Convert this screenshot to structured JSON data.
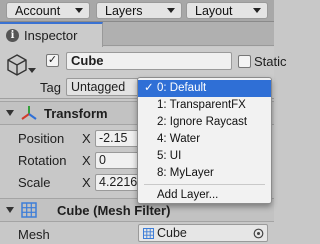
{
  "toolbar": {
    "account": "Account",
    "layers": "Layers",
    "layout": "Layout"
  },
  "tab": {
    "label": "Inspector"
  },
  "object": {
    "name": "Cube",
    "static_label": "Static",
    "tag_label": "Tag",
    "tag_value": "Untagged"
  },
  "transform": {
    "title": "Transform",
    "rows": [
      {
        "label": "Position",
        "x": "-2.15"
      },
      {
        "label": "Rotation",
        "x": "0"
      },
      {
        "label": "Scale",
        "x": "4.2216"
      }
    ],
    "axis_x": "X"
  },
  "mesh_filter": {
    "title": "Cube (Mesh Filter)",
    "mesh_label": "Mesh",
    "mesh_value": "Cube"
  },
  "layer_menu": {
    "check": "✓",
    "items": [
      "0: Default",
      "1: TransparentFX",
      "2: Ignore Raycast",
      "4: Water",
      "5: UI",
      "8: MyLayer"
    ],
    "add_layer": "Add Layer..."
  },
  "colors": {
    "selection": "#2f6fd6",
    "tab_accent": "#3a72d2",
    "transform_red": "#d23b2b",
    "transform_green": "#34a03b",
    "transform_blue": "#2f6fd6",
    "mesh_blue": "#3e7ed8"
  }
}
